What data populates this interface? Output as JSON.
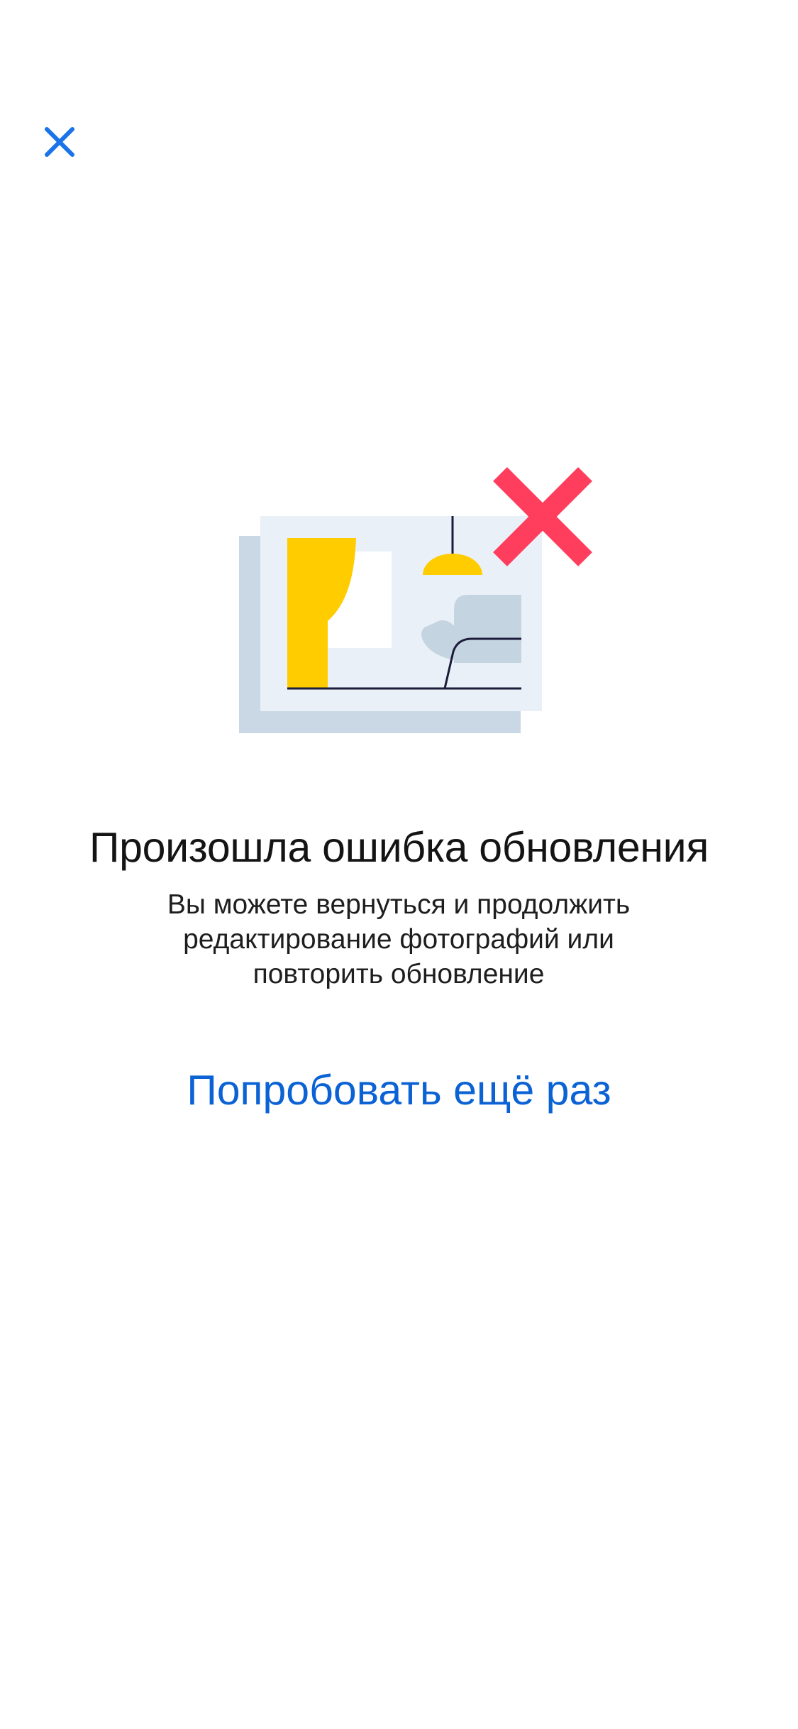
{
  "toolbar": {
    "close_icon": "close-icon"
  },
  "illustration": {
    "icon": "photo-room-error-illustration"
  },
  "error": {
    "title": "Произошла ошибка обновления",
    "message": "Вы можете вернуться и продолжить редактирование фотографий или повторить обновление"
  },
  "actions": {
    "retry_label": "Попробовать ещё раз"
  },
  "colors": {
    "accent": "#0a62d4",
    "close_icon": "#1a73e8",
    "error_cross": "#ff3d5c",
    "yellow": "#ffcc00",
    "frame_back": "#c9d8e4",
    "frame_front": "#eaf0f7",
    "sofa": "#c5d4e1",
    "line": "#1c1c3a"
  }
}
